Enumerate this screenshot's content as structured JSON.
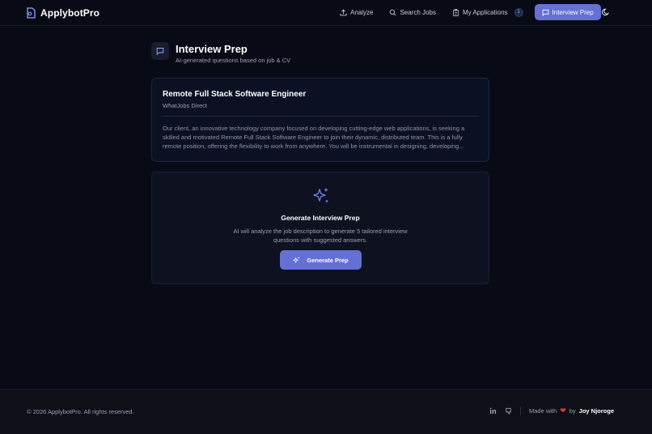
{
  "brand": {
    "name": "ApplybotPro"
  },
  "nav": {
    "analyze": "Analyze",
    "search_jobs": "Search Jobs",
    "my_applications": "My Applications",
    "applications_count": "1",
    "interview_prep": "Interview Prep"
  },
  "page": {
    "title": "Interview Prep",
    "subtitle": "AI-generated questions based on job & CV"
  },
  "job": {
    "title": "Remote Full Stack Software Engineer",
    "company": "WhatJobs Direct",
    "description": "Our client, an innovative technology company focused on developing cutting-edge web applications, is seeking a skilled and motivated Remote Full Stack Software Engineer to join their dynamic, distributed team. This is a fully remote position, offering the flexibility to work from anywhere. You will be instrumental in designing, developing..."
  },
  "generate": {
    "title": "Generate Interview Prep",
    "description": "AI will analyze the job description to generate 5 tailored interview questions with suggested answers.",
    "button_label": "Generate Prep"
  },
  "footer": {
    "copyright": "© 2026 ApplybotPro. All rights reserved.",
    "made_with": "Made with",
    "by": "by",
    "author": "Joy Njoroge"
  },
  "colors": {
    "accent": "#6570d4",
    "background": "#080b16",
    "heart": "#e03b3b"
  }
}
